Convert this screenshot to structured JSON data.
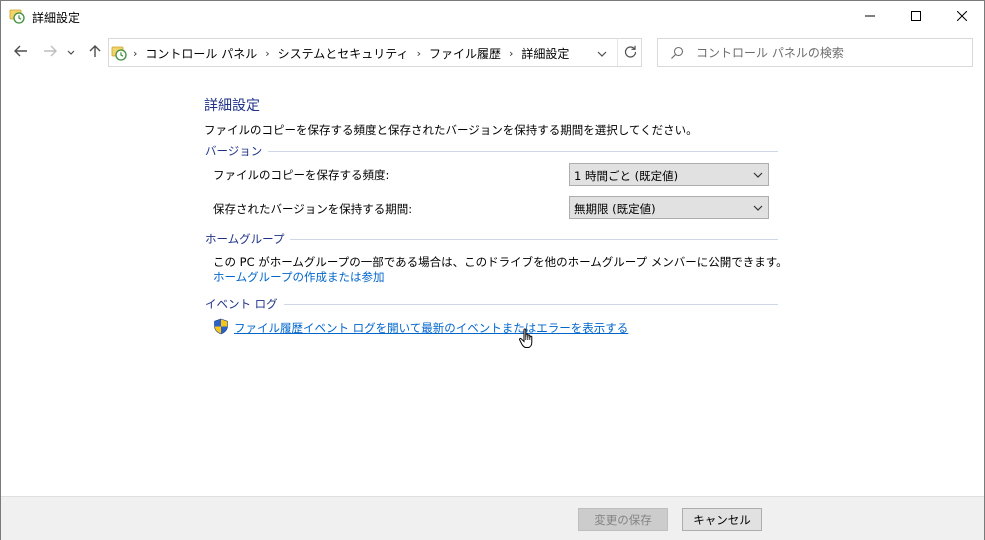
{
  "window": {
    "title": "詳細設定"
  },
  "navigation": {
    "breadcrumbs": [
      "コントロール パネル",
      "システムとセキュリティ",
      "ファイル履歴",
      "詳細設定"
    ],
    "search_placeholder": "コントロール パネルの検索"
  },
  "main": {
    "title": "詳細設定",
    "description": "ファイルのコピーを保存する頻度と保存されたバージョンを保持する期間を選択してください。",
    "versions": {
      "header": "バージョン",
      "frequency_label": "ファイルのコピーを保存する頻度:",
      "frequency_value": "1 時間ごと (既定値)",
      "retention_label": "保存されたバージョンを保持する期間:",
      "retention_value": "無期限 (既定値)"
    },
    "homegroup": {
      "header": "ホームグループ",
      "text": "この PC がホームグループの一部である場合は、このドライブを他のホームグループ メンバーに公開できます。",
      "link": "ホームグループの作成または参加"
    },
    "eventlog": {
      "header": "イベント ログ",
      "link": "ファイル履歴イベント ログを開いて最新のイベントまたはエラーを表示する"
    }
  },
  "footer": {
    "save_label": "変更の保存",
    "cancel_label": "キャンセル"
  },
  "colors": {
    "heading_blue": "#1e3287",
    "link_blue": "#0066cc",
    "footer_bg": "#f0f0f0"
  },
  "icons": [
    "file-history-icon",
    "minimize-icon",
    "maximize-icon",
    "close-icon",
    "back-arrow-icon",
    "forward-arrow-icon",
    "recent-dropdown-icon",
    "up-arrow-icon",
    "chevron-down-icon",
    "refresh-icon",
    "search-icon",
    "uac-shield-icon",
    "hand-cursor-icon"
  ]
}
